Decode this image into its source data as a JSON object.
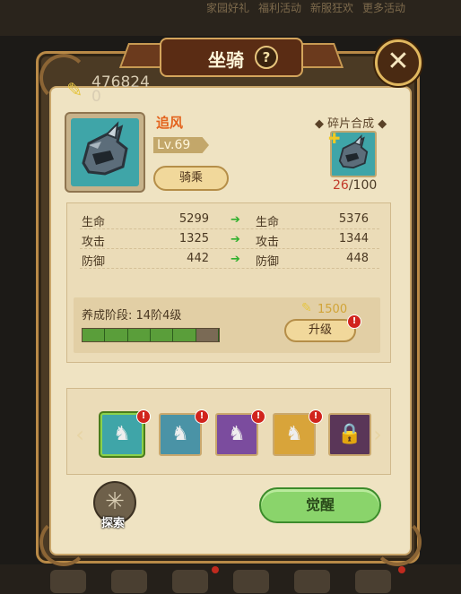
{
  "background": {
    "top_tabs": [
      "家园好礼",
      "福利活动",
      "新服狂欢",
      "更多活动"
    ],
    "bottom_badge_count": 3
  },
  "header": {
    "title": "坐骑",
    "help_icon": "question-mark-icon",
    "close_icon": "close-x-icon"
  },
  "power": {
    "icon": "feather-icon",
    "value": "476824",
    "value2": "0"
  },
  "mount": {
    "name": "追风",
    "level": "Lv.69",
    "ride_label": "骑乘",
    "portrait_icon": "rhino-helmet-icon"
  },
  "fragments": {
    "title": "碎片合成",
    "current": "26",
    "total": "/100",
    "icon": "rhino-helmet-icon"
  },
  "stats": [
    {
      "label": "生命",
      "current": "5299",
      "label2": "生命",
      "next": "5376"
    },
    {
      "label": "攻击",
      "current": "1325",
      "label2": "攻击",
      "next": "1344"
    },
    {
      "label": "防御",
      "current": "442",
      "label2": "防御",
      "next": "448"
    }
  ],
  "training": {
    "label": "养成阶段:",
    "stage": "14阶4级",
    "progress_filled": 5,
    "progress_total": 6,
    "cost": "1500",
    "upgrade_label": "升级",
    "alert": "!"
  },
  "carousel": {
    "slots": [
      {
        "name": "rhino-helmet-icon",
        "glyph": "♞",
        "bg": "#3fa5a8",
        "alert": "!",
        "selected": true
      },
      {
        "name": "dark-rhino-icon",
        "glyph": "♞",
        "bg": "#4a93a6",
        "alert": "!",
        "selected": false
      },
      {
        "name": "deer-mount-icon",
        "glyph": "♞",
        "bg": "#7b4c9e",
        "alert": "!",
        "selected": false
      },
      {
        "name": "white-goat-icon",
        "glyph": "♞",
        "bg": "#d8a43a",
        "alert": "!",
        "selected": false
      },
      {
        "name": "locked-mount-icon",
        "glyph": "🔒",
        "bg": "#5a3658",
        "alert": "",
        "selected": false
      }
    ]
  },
  "actions": {
    "explore_label": "探索",
    "awaken_label": "觉醒"
  }
}
